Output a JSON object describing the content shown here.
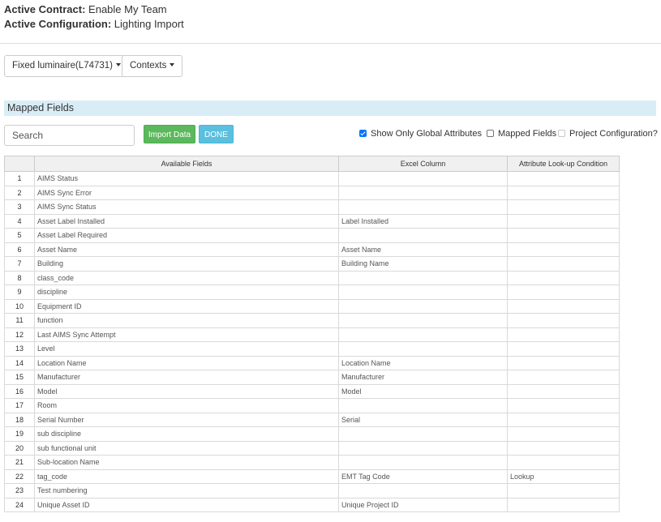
{
  "header": {
    "contract_label": "Active Contract:",
    "contract_value": "Enable My Team",
    "configuration_label": "Active Configuration:",
    "configuration_value": "Lighting Import"
  },
  "toolbar": {
    "asset_class_dropdown": "Fixed luminaire(L74731)",
    "contexts_dropdown": "Contexts"
  },
  "panel": {
    "title": "Mapped Fields"
  },
  "search": {
    "placeholder": "Search",
    "value": ""
  },
  "buttons": {
    "import": "Import Data",
    "done": "DONE"
  },
  "options": [
    {
      "label": "Show Only Global Attributes",
      "checked": true,
      "disabled": false
    },
    {
      "label": "Mapped Fields",
      "checked": false,
      "disabled": false
    },
    {
      "label": "Project Configuration?",
      "checked": false,
      "disabled": true
    }
  ],
  "table": {
    "columns": [
      "",
      "Available Fields",
      "Excel Column",
      "Attribute Look-up Condition"
    ],
    "rows": [
      {
        "num": "1",
        "field": "AIMS Status",
        "excel": "",
        "lookup": ""
      },
      {
        "num": "2",
        "field": "AIMS Sync Error",
        "excel": "",
        "lookup": ""
      },
      {
        "num": "3",
        "field": "AIMS Sync Status",
        "excel": "",
        "lookup": ""
      },
      {
        "num": "4",
        "field": "Asset Label Installed",
        "excel": "Label Installed",
        "lookup": ""
      },
      {
        "num": "5",
        "field": "Asset Label Required",
        "excel": "",
        "lookup": ""
      },
      {
        "num": "6",
        "field": "Asset Name",
        "excel": "Asset Name",
        "lookup": ""
      },
      {
        "num": "7",
        "field": "Building",
        "excel": "Building Name",
        "lookup": ""
      },
      {
        "num": "8",
        "field": "class_code",
        "excel": "",
        "lookup": ""
      },
      {
        "num": "9",
        "field": "discipline",
        "excel": "",
        "lookup": ""
      },
      {
        "num": "10",
        "field": "Equipment ID",
        "excel": "",
        "lookup": ""
      },
      {
        "num": "11",
        "field": "function",
        "excel": "",
        "lookup": ""
      },
      {
        "num": "12",
        "field": "Last AIMS Sync Attempt",
        "excel": "",
        "lookup": ""
      },
      {
        "num": "13",
        "field": "Level",
        "excel": "",
        "lookup": ""
      },
      {
        "num": "14",
        "field": "Location Name",
        "excel": "Location Name",
        "lookup": ""
      },
      {
        "num": "15",
        "field": "Manufacturer",
        "excel": "Manufacturer",
        "lookup": ""
      },
      {
        "num": "16",
        "field": "Model",
        "excel": "Model",
        "lookup": ""
      },
      {
        "num": "17",
        "field": "Room",
        "excel": "",
        "lookup": ""
      },
      {
        "num": "18",
        "field": "Serial Number",
        "excel": "Serial",
        "lookup": ""
      },
      {
        "num": "19",
        "field": "sub discipline",
        "excel": "",
        "lookup": ""
      },
      {
        "num": "20",
        "field": "sub functional unit",
        "excel": "",
        "lookup": ""
      },
      {
        "num": "21",
        "field": "Sub-location Name",
        "excel": "",
        "lookup": ""
      },
      {
        "num": "22",
        "field": "tag_code",
        "excel": "EMT Tag Code",
        "lookup": "Lookup"
      },
      {
        "num": "23",
        "field": "Test numbering",
        "excel": "",
        "lookup": ""
      },
      {
        "num": "24",
        "field": "Unique Asset ID",
        "excel": "Unique Project ID",
        "lookup": ""
      }
    ]
  }
}
